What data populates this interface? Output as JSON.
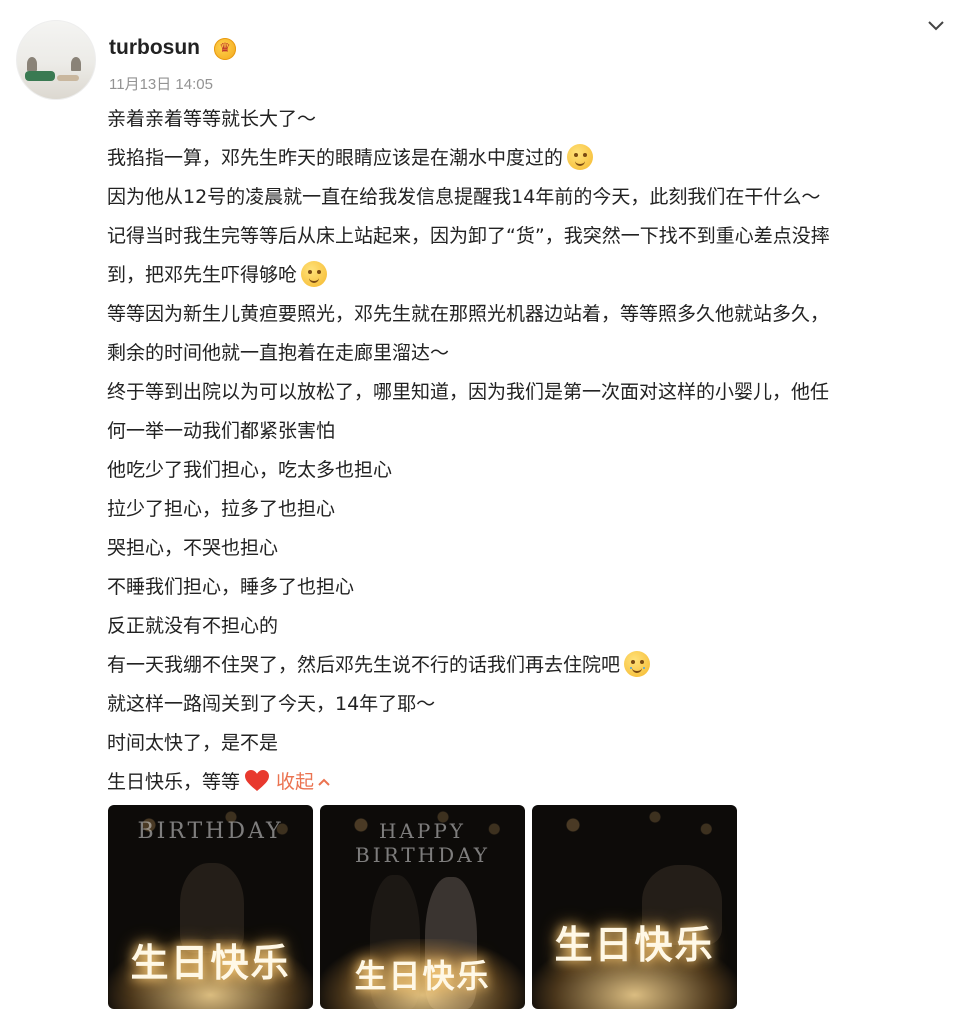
{
  "header": {
    "username": "turbosun",
    "timestamp": "11月13日 14:05",
    "avatar_icon": "avatar-image",
    "badge_icon": "vip-crown-icon",
    "menu_icon": "chevron-down-icon"
  },
  "post": {
    "lines": [
      "亲着亲着等等就长大了～",
      "我掐指一算，邓先生昨天的眼睛应该是在潮水中度过的",
      "因为他从12号的凌晨就一直在给我发信息提醒我14年前的今天，此刻我们在干什么～",
      "记得当时我生完等等后从床上站起来，因为卸了“货”，我突然一下找不到重心差点没摔",
      "到，把邓先生吓得够呛",
      "等等因为新生儿黄疸要照光，邓先生就在那照光机器边站着，等等照多久他就站多久，",
      "剩余的时间他就一直抱着在走廊里溜达～",
      "终于等到出院以为可以放松了，哪里知道，因为我们是第一次面对这样的小婴儿，他任",
      "何一举一动我们都紧张害怕",
      "他吃少了我们担心，吃太多也担心",
      "拉少了担心，拉多了也担心",
      "哭担心，不哭也担心",
      "不睡我们担心，睡多了也担心",
      "反正就没有不担心的",
      "有一天我绷不住哭了，然后邓先生说不行的话我们再去住院吧",
      "就这样一路闯关到了今天，14年了耶～",
      "时间太快了，是不是",
      "生日快乐，等等"
    ],
    "collapse_label": "收起",
    "accent_color": "#eb7350",
    "heart_color": "#e8392e"
  },
  "photos": [
    {
      "neon_text": "BIRTHDAY",
      "cake_text": "生日快乐"
    },
    {
      "neon_text": "HAPPY BIRTHDAY",
      "cake_text": "生日快乐"
    },
    {
      "neon_text": "",
      "cake_text": "生日快乐"
    }
  ]
}
